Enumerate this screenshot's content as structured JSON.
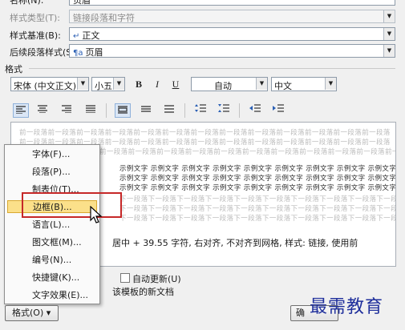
{
  "fields": {
    "name_label": "名称(N):",
    "name_value": "页眉",
    "style_type_label": "样式类型(T):",
    "style_type_value": "链接段落和字符",
    "based_on_label": "样式基准(B):",
    "based_on_value": "正文",
    "next_style_label": "后续段落样式(S):",
    "next_style_value": "页眉"
  },
  "format_section": {
    "label": "格式",
    "font_name": "宋体 (中文正文)",
    "font_size": "小五",
    "bold": "B",
    "italic": "I",
    "underline": "U",
    "color": "自动",
    "language": "中文"
  },
  "preview": {
    "prev_para": "前一段落前一段落前一段落前一段落前一段落前一段落前一段落前一段落前一段落前一段落前一段落前一段落前一段落",
    "sample_text": "示例文字 示例文字 示例文字 示例文字 示例文字 示例文字 示例文字 示例文字 示例文字 示例文字",
    "next_para": "下一段落下一段落下一段落下一段落下一段落下一段落下一段落下一段落下一段落下一段落下一段落下一段落"
  },
  "description": {
    "line1": "居中 + 39.55 字符, 右对齐, 不对齐到网格, 样式: 链接, 使用前",
    "line2": "该模板的新文档"
  },
  "options": {
    "auto_update": "自动更新(U)"
  },
  "context_menu": {
    "items": [
      "字体(F)...",
      "段落(P)...",
      "制表位(T)...",
      "边框(B)...",
      "语言(L)...",
      "图文框(M)...",
      "编号(N)...",
      "快捷键(K)...",
      "文字效果(E)..."
    ],
    "highlighted_index": 3
  },
  "buttons": {
    "format": "格式(O) ▾",
    "ok": "确"
  },
  "watermark": "最需教育",
  "colors": {
    "highlight": "#fbe08a",
    "annotation_red": "#c62828",
    "watermark_blue": "#1f2f9c"
  }
}
